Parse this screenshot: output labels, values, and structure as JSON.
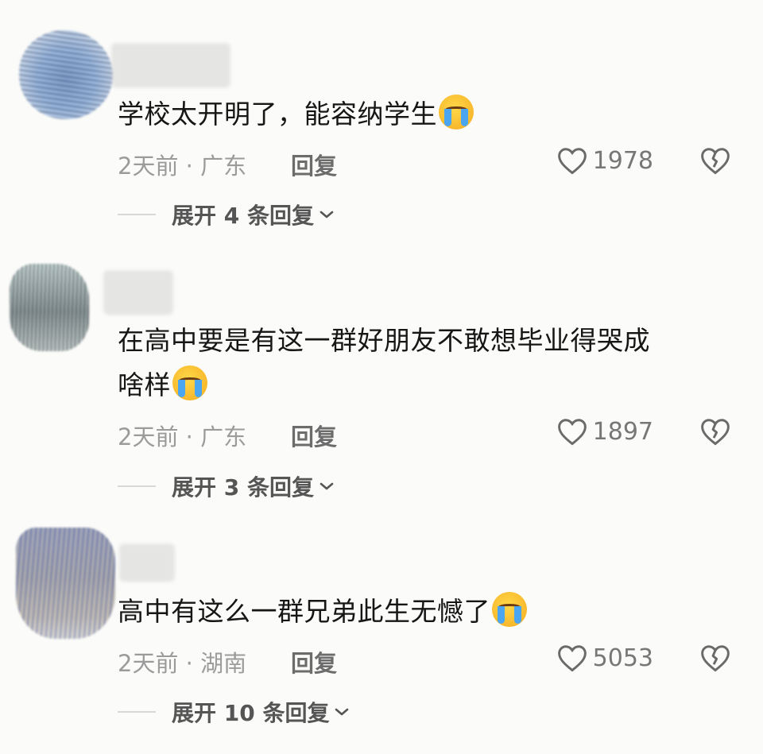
{
  "comments": [
    {
      "text": "学校太开明了，能容纳学生",
      "emoji": "loudly-crying-face",
      "meta": "2天前 · 广东",
      "reply": "回复",
      "likes": "1978",
      "expand": "展开 4 条回复"
    },
    {
      "text_line1": "在高中要是有这一群好朋友不敢想毕业得哭成",
      "text_line2": "啥样",
      "emoji": "face-holding-back-tears",
      "meta": "2天前 · 广东",
      "reply": "回复",
      "likes": "1897",
      "expand": "展开 3 条回复"
    },
    {
      "text": "高中有这么一群兄弟此生无憾了",
      "emoji": "loudly-crying-face",
      "meta": "2天前 · 湖南",
      "reply": "回复",
      "likes": "5053",
      "expand": "展开 10 条回复"
    }
  ],
  "icons": {
    "like": "heart-outline-icon",
    "dislike": "broken-heart-icon",
    "expand": "chevron-down-icon"
  }
}
